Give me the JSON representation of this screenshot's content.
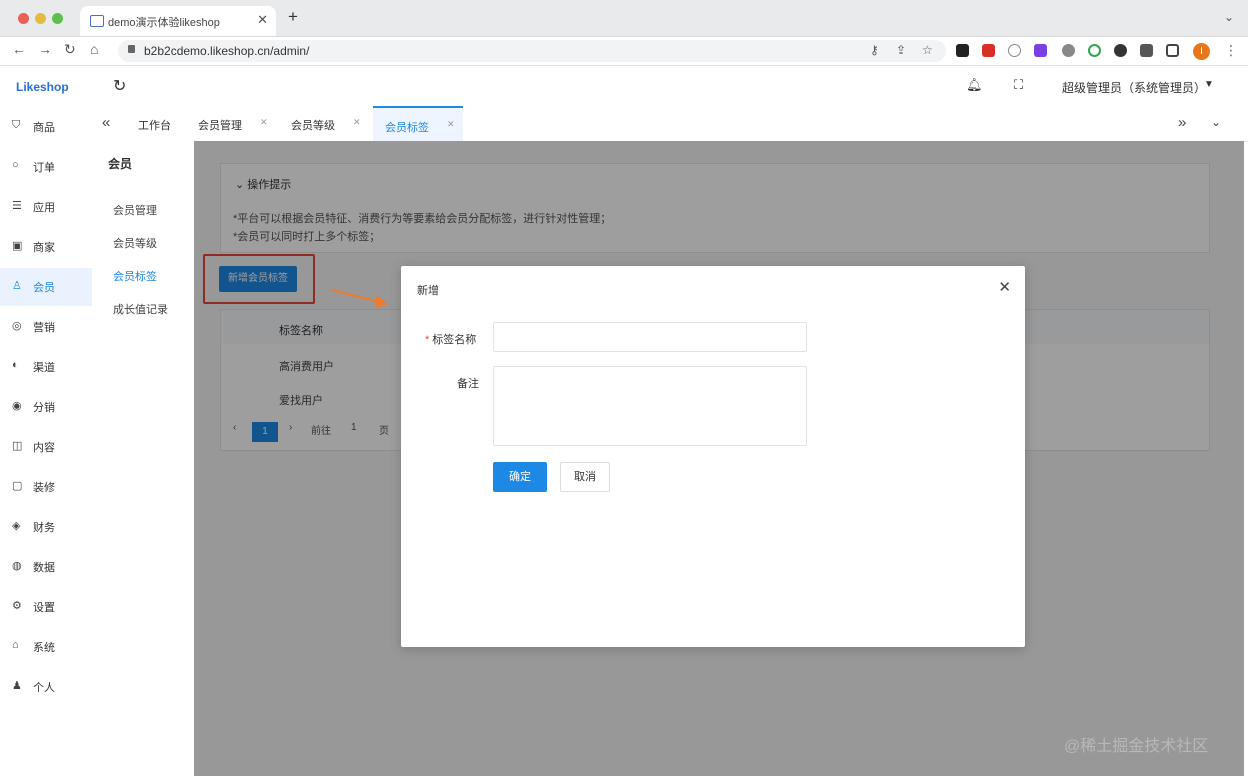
{
  "browser": {
    "tab_title": "demo演示体验likeshop",
    "url": "b2b2cdemo.likeshop.cn/admin/",
    "avatar_initial": "I"
  },
  "header": {
    "logo": "Likeshop",
    "user": "超级管理员（系统管理员）"
  },
  "sidebar": {
    "items": [
      {
        "icon": "cart-icon",
        "glyph": "⛉",
        "label": "商品"
      },
      {
        "icon": "order-icon",
        "glyph": "○",
        "label": "订单"
      },
      {
        "icon": "app-icon",
        "glyph": "☰",
        "label": "应用"
      },
      {
        "icon": "shop-icon",
        "glyph": "▣",
        "label": "商家"
      },
      {
        "icon": "user-icon",
        "glyph": "♙",
        "label": "会员"
      },
      {
        "icon": "marketing-icon",
        "glyph": "◎",
        "label": "营销"
      },
      {
        "icon": "channel-icon",
        "glyph": "◐",
        "label": "渠道"
      },
      {
        "icon": "distribution-icon",
        "glyph": "◉",
        "label": "分销"
      },
      {
        "icon": "content-icon",
        "glyph": "◫",
        "label": "内容"
      },
      {
        "icon": "decorate-icon",
        "glyph": "▢",
        "label": "装修"
      },
      {
        "icon": "finance-icon",
        "glyph": "◈",
        "label": "财务"
      },
      {
        "icon": "data-icon",
        "glyph": "◍",
        "label": "数据"
      },
      {
        "icon": "settings-icon",
        "glyph": "⚙",
        "label": "设置"
      },
      {
        "icon": "system-icon",
        "glyph": "⌂",
        "label": "系统"
      },
      {
        "icon": "personal-icon",
        "glyph": "♟",
        "label": "个人"
      }
    ]
  },
  "subnav": {
    "title": "会员",
    "items": [
      "会员管理",
      "会员等级",
      "会员标签",
      "成长值记录"
    ]
  },
  "tabs": [
    "工作台",
    "会员管理",
    "会员等级",
    "会员标签"
  ],
  "tips": {
    "title": "操作提示",
    "lines": [
      "*平台可以根据会员特征、消费行为等要素给会员分配标签，进行针对性管理；",
      "*会员可以同时打上多个标签；"
    ]
  },
  "add_button": "新增会员标签",
  "table": {
    "header": "标签名称",
    "rows": [
      "高消费用户",
      "爱找用户"
    ],
    "pager": {
      "prev": "‹",
      "current": "1",
      "next": "›",
      "goto": "前往",
      "page_input": "1",
      "unit": "页"
    }
  },
  "modal": {
    "title": "新增",
    "fields": {
      "name_label": "标签名称",
      "name_value": "",
      "remark_label": "备注",
      "remark_value": ""
    },
    "confirm": "确定",
    "cancel": "取消"
  },
  "watermark": "@稀土掘金技术社区",
  "colors": {
    "primary": "#1e88e5",
    "highlight_border": "#e6473a",
    "arrow": "#f07a2b"
  }
}
